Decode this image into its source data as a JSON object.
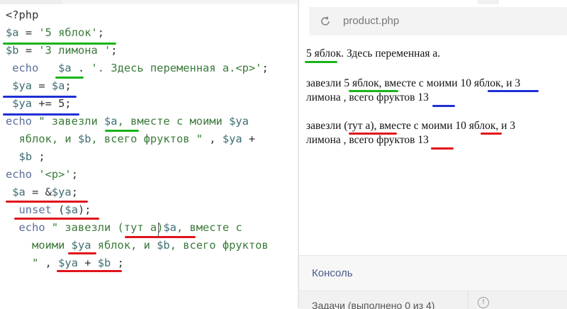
{
  "editor": {
    "lines": [
      {
        "parts": [
          [
            "plain",
            "<?php"
          ]
        ]
      },
      {
        "parts": [
          [
            "var",
            "$a"
          ],
          [
            "plain",
            " = "
          ],
          [
            "str",
            "'5 яблок'"
          ],
          [
            "plain",
            ";"
          ]
        ]
      },
      {
        "parts": [
          [
            "var",
            "$b"
          ],
          [
            "plain",
            " = "
          ],
          [
            "str",
            "'3 лимона '"
          ],
          [
            "plain",
            ";"
          ]
        ]
      },
      {
        "parts": [
          [
            "kw",
            " echo"
          ],
          [
            "plain",
            "   "
          ],
          [
            "var",
            "$a"
          ],
          [
            "plain",
            " . "
          ],
          [
            "str",
            "'. Здесь переменная а.<p>'"
          ],
          [
            "plain",
            ";"
          ]
        ]
      },
      {
        "parts": [
          [
            "var",
            " $ya"
          ],
          [
            "plain",
            " = "
          ],
          [
            "var",
            "$a"
          ],
          [
            "plain",
            ";"
          ]
        ]
      },
      {
        "parts": [
          [
            "var",
            " $ya"
          ],
          [
            "plain",
            " += 5;"
          ]
        ]
      },
      {
        "parts": [
          [
            "kw",
            "echo"
          ],
          [
            "str",
            " \" завезли "
          ],
          [
            "var",
            "$a"
          ],
          [
            "str",
            ", вместе с моими "
          ],
          [
            "var",
            "$ya"
          ]
        ]
      },
      {
        "parts": [
          [
            "str",
            "  яблок, и "
          ],
          [
            "var",
            "$b"
          ],
          [
            "str",
            ", всего фруктов \""
          ],
          [
            "plain",
            " , "
          ],
          [
            "var",
            "$ya"
          ],
          [
            "plain",
            " +"
          ]
        ]
      },
      {
        "parts": [
          [
            "plain",
            "  "
          ],
          [
            "var",
            "$b"
          ],
          [
            "plain",
            " ;"
          ]
        ]
      },
      {
        "parts": [
          [
            "kw",
            "echo"
          ],
          [
            "plain",
            " "
          ],
          [
            "str",
            "'<p>'"
          ],
          [
            "plain",
            ";"
          ]
        ]
      },
      {
        "parts": [
          [
            "var",
            " $a"
          ],
          [
            "plain",
            " = &"
          ],
          [
            "var",
            "$ya"
          ],
          [
            "plain",
            ";"
          ]
        ]
      },
      {
        "parts": [
          [
            "kw",
            "  unset"
          ],
          [
            "plain",
            " ("
          ],
          [
            "var",
            "$a"
          ],
          [
            "plain",
            ");"
          ]
        ]
      },
      {
        "parts": [
          [
            "kw",
            "  echo"
          ],
          [
            "str",
            " \" завезли (тут а)"
          ],
          [
            "var",
            "$a"
          ],
          [
            "str",
            ", вместе с"
          ]
        ]
      },
      {
        "parts": [
          [
            "str",
            "    моими "
          ],
          [
            "var",
            "$ya"
          ],
          [
            "str",
            " яблок, и "
          ],
          [
            "var",
            "$b"
          ],
          [
            "str",
            ", всего фруктов"
          ]
        ]
      },
      {
        "parts": [
          [
            "str",
            "    \""
          ],
          [
            "plain",
            " , "
          ],
          [
            "var",
            "$ya"
          ],
          [
            "plain",
            " + "
          ],
          [
            "var",
            "$b"
          ],
          [
            "plain",
            " ;"
          ]
        ]
      }
    ]
  },
  "preview": {
    "filename": "product.php",
    "output": [
      "5 яблок. Здесь переменная а.",
      "завезли 5 яблок, вместе с моими 10 яблок, и 3",
      "лимона , всего фруктов 13",
      "завезли (тут а), вместе с моими 10 яблок, и 3",
      "лимона , всего фруктов 13"
    ]
  },
  "console": {
    "label": "Консоль"
  },
  "tasks": {
    "label": "Задачи (выполнено 0 из 4)",
    "info": "!"
  },
  "colors": {
    "green": "#19b419",
    "blue": "#1f2fd6",
    "red": "#e0141c",
    "var": "#3f6e73",
    "string": "#3a7a3a"
  }
}
